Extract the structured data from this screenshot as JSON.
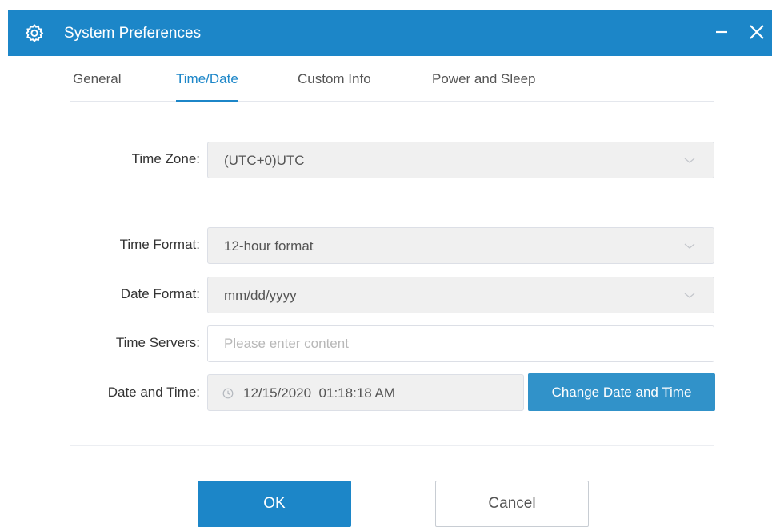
{
  "window": {
    "title": "System Preferences",
    "app_icon": "gear-icon",
    "minimize_icon": "minimize-icon",
    "close_icon": "close-icon",
    "accent_color": "#1c86c8"
  },
  "tabs": [
    {
      "label": "General",
      "active": false
    },
    {
      "label": "Time/Date",
      "active": true
    },
    {
      "label": "Custom Info",
      "active": false
    },
    {
      "label": "Power and Sleep",
      "active": false
    }
  ],
  "form": {
    "time_zone": {
      "label": "Time Zone:",
      "value": "(UTC+0)UTC",
      "icon": "chevron-down-icon"
    },
    "time_format": {
      "label": "Time Format:",
      "value": "12-hour format",
      "icon": "chevron-down-icon"
    },
    "date_format": {
      "label": "Date Format:",
      "value": "mm/dd/yyyy",
      "icon": "chevron-down-icon"
    },
    "time_servers": {
      "label": "Time Servers:",
      "value": "",
      "placeholder": "Please enter content"
    },
    "date_and_time": {
      "label": "Date and Time:",
      "value": "12/15/2020  01:18:18 AM",
      "icon": "clock-icon"
    },
    "change_button": "Change Date and Time"
  },
  "footer": {
    "ok_label": "OK",
    "cancel_label": "Cancel"
  }
}
